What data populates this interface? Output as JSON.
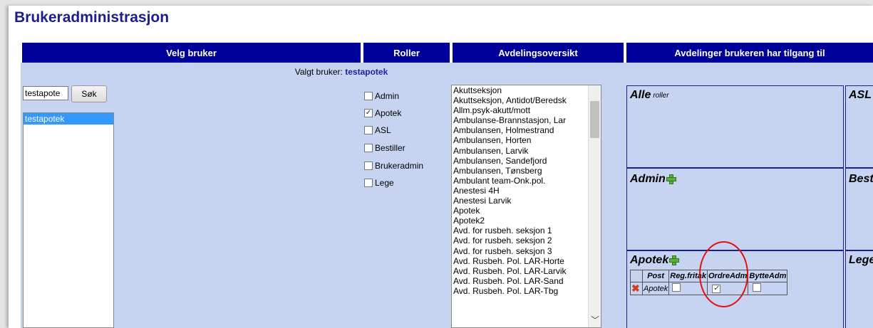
{
  "page": {
    "title": "Brukeradministrasjon"
  },
  "headers": [
    "Velg bruker",
    "Roller",
    "Avdelingsoversikt",
    "Avdelinger brukeren har tilgang til"
  ],
  "selected_user": {
    "label": "Valgt bruker:",
    "value": "testapotek"
  },
  "search": {
    "value": "testapote",
    "button": "Søk"
  },
  "users": [
    "testapotek"
  ],
  "roles": [
    {
      "label": "Admin",
      "checked": false
    },
    {
      "label": "Apotek",
      "checked": true
    },
    {
      "label": "ASL",
      "checked": false
    },
    {
      "label": "Bestiller",
      "checked": false
    },
    {
      "label": "Brukeradmin",
      "checked": false
    },
    {
      "label": "Lege",
      "checked": false
    }
  ],
  "departments": [
    "Akuttseksjon",
    "Akuttseksjon, Antidot/Beredsk",
    "Allm.psyk-akutt/mott",
    "Ambulanse-Brannstasjon, Lar",
    "Ambulansen, Holmestrand",
    "Ambulansen, Horten",
    "Ambulansen, Larvik",
    "Ambulansen, Sandefjord",
    "Ambulansen, Tønsberg",
    "Ambulant team-Onk.pol.",
    "Anestesi 4H",
    "Anestesi Larvik",
    "Apotek",
    "Apotek2",
    "Avd. for rusbeh. seksjon 1",
    "Avd. for rusbeh. seksjon 2",
    "Avd. for rusbeh. seksjon 3",
    "Avd. Rusbeh. Pol. LAR-Horte",
    "Avd. Rusbeh. Pol. LAR-Larvik",
    "Avd. Rusbeh. Pol. LAR-Sand",
    "Avd. Rusbeh. Pol. LAR-Tbg"
  ],
  "access_boxes": {
    "alle": {
      "title": "Alle",
      "subtitle": "roller"
    },
    "asl": {
      "title": "ASL"
    },
    "admin": {
      "title": "Admin"
    },
    "best": {
      "title": "Best"
    },
    "apotek": {
      "title": "Apotek",
      "columns": [
        "Post",
        "Reg.fritak",
        "OrdreAdm",
        "BytteAdm"
      ],
      "rows": [
        {
          "post": "Apotek",
          "reg_fritak": false,
          "ordre_adm": true,
          "bytte_adm": false
        }
      ]
    },
    "lege": {
      "title": "Lege"
    }
  }
}
